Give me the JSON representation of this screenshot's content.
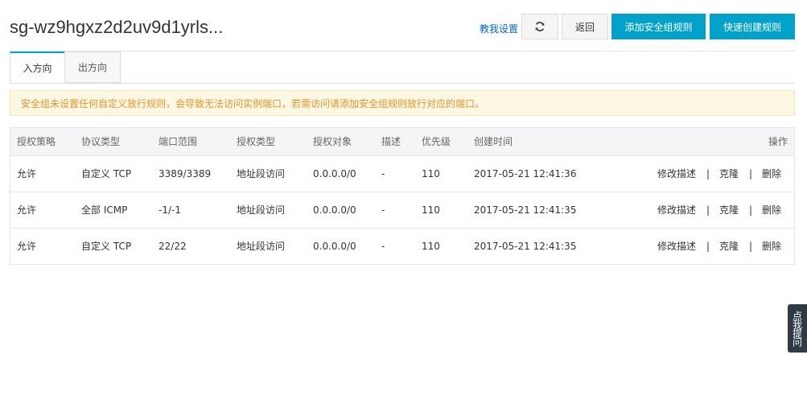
{
  "header": {
    "title": "sg-wz9hgxz2d2uv9d1yrls...",
    "tutorial_link": "教我设置",
    "refresh_icon": "refresh-icon",
    "back_label": "返回",
    "add_rule_label": "添加安全组规则",
    "quick_create_label": "快速创建规则"
  },
  "tabs": [
    {
      "label": "入方向",
      "active": true
    },
    {
      "label": "出方向",
      "active": false
    }
  ],
  "notice": "安全组未设置任何自定义放行规则，会导致无法访问实例端口，若需访问请添加安全组规则放行对应的端口。",
  "table": {
    "columns": [
      "授权策略",
      "协议类型",
      "端口范围",
      "授权类型",
      "授权对象",
      "描述",
      "优先级",
      "创建时间",
      "操作"
    ],
    "rows": [
      {
        "policy": "允许",
        "protocol": "自定义 TCP",
        "port": "3389/3389",
        "auth_type": "地址段访问",
        "auth_object": "0.0.0.0/0",
        "desc": "-",
        "priority": "110",
        "created": "2017-05-21 12:41:36"
      },
      {
        "policy": "允许",
        "protocol": "全部 ICMP",
        "port": "-1/-1",
        "auth_type": "地址段访问",
        "auth_object": "0.0.0.0/0",
        "desc": "-",
        "priority": "110",
        "created": "2017-05-21 12:41:35"
      },
      {
        "policy": "允许",
        "protocol": "自定义 TCP",
        "port": "22/22",
        "auth_type": "地址段访问",
        "auth_object": "0.0.0.0/0",
        "desc": "-",
        "priority": "110",
        "created": "2017-05-21 12:41:35"
      }
    ],
    "actions": {
      "edit_desc": "修改描述",
      "clone": "克隆",
      "delete": "删除",
      "separator": "|"
    }
  },
  "float_help": "点我提问",
  "colors": {
    "primary": "#00a2ca",
    "link": "#0066cc",
    "notice_text": "#e7922a",
    "notice_bg": "#fcf8e3"
  }
}
